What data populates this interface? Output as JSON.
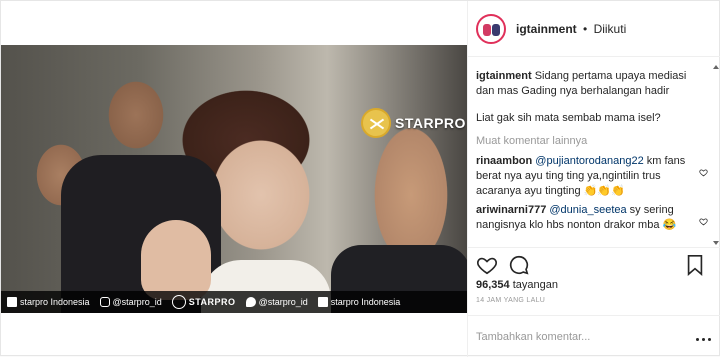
{
  "header": {
    "username": "igtainment",
    "separator": "•",
    "follow_status": "Diikuti"
  },
  "media": {
    "watermark": "STARPRO",
    "bar": [
      {
        "icon": "facebook-icon",
        "text": "starpro Indonesia"
      },
      {
        "icon": "instagram-icon",
        "text": "@starpro_id"
      },
      {
        "icon": "starpro-logo-icon",
        "text": "STARPRO"
      },
      {
        "icon": "twitter-icon",
        "text": "@starpro_id"
      },
      {
        "icon": "youtube-icon",
        "text": "starpro Indonesia"
      }
    ]
  },
  "caption": {
    "user": "igtainment",
    "text1": "Sidang pertama upaya mediasi dan mas Gading nya berhalangan hadir",
    "text2": "Liat gak sih mata sembab mama isel?"
  },
  "more_comments": "Muat komentar lainnya",
  "comments": [
    {
      "user": "rinaambon",
      "mention": "@pujiantorodanang22",
      "text": " km fans berat nya ayu ting ting ya,ngintilin trus acaranya ayu tingting 👏👏👏"
    },
    {
      "user": "ariwinarni777",
      "mention": "@dunia_seetea",
      "text": " sy sering nangisnya klo hbs nonton drakor mba 😂"
    }
  ],
  "stats": {
    "views_count": "96,354",
    "views_label": "tayangan",
    "time": "14 JAM YANG LALU"
  },
  "add_comment": {
    "placeholder": "Tambahkan komentar..."
  }
}
